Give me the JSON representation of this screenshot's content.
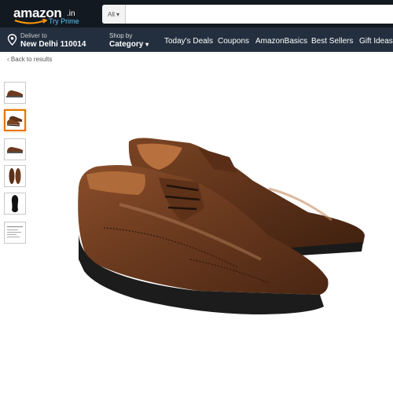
{
  "header": {
    "logo": {
      "name": "amazon",
      "tld": ".in",
      "prime_text": "Try Prime"
    },
    "search": {
      "category": "All",
      "placeholder": ""
    },
    "deliver": {
      "line1": "Deliver to",
      "line2": "New Delhi 110014"
    },
    "shop_by": {
      "line1": "Shop by",
      "line2": "Category"
    },
    "nav_links": [
      "Today's Deals",
      "Coupons",
      "AmazonBasics",
      "Best Sellers",
      "Gift Ideas"
    ]
  },
  "breadcrumb": {
    "back_label": "Back to results"
  },
  "gallery": {
    "selected_index": 1,
    "thumbnails": [
      {
        "kind": "pair-side-view"
      },
      {
        "kind": "pair-angled-view"
      },
      {
        "kind": "single-side-view"
      },
      {
        "kind": "pair-top-view"
      },
      {
        "kind": "sole-view"
      },
      {
        "kind": "size-chart"
      }
    ]
  },
  "colors": {
    "header_top": "#131921",
    "header_nav": "#232f3e",
    "prime_blue": "#5ac8fa",
    "smile_orange": "#ff9900",
    "selected_border": "#e77600",
    "shoe_brown": "#6b3a1f"
  }
}
